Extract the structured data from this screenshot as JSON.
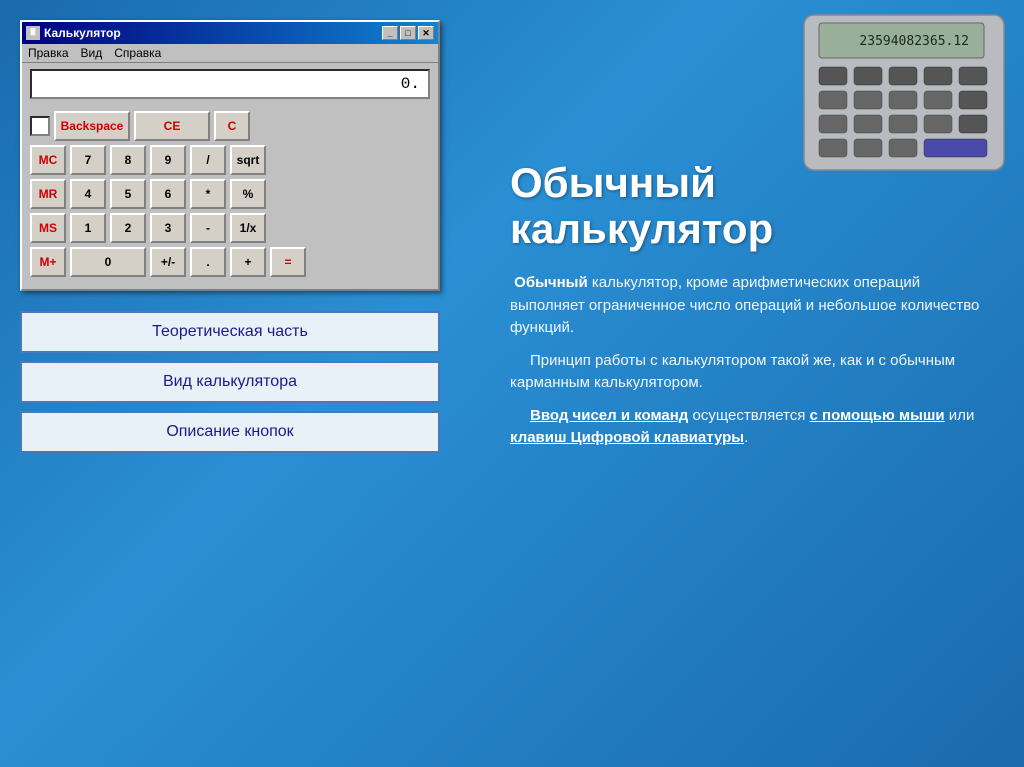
{
  "title": "Калькулятор",
  "titlebar": {
    "title": "Калькулятор",
    "min_btn": "_",
    "max_btn": "□",
    "close_btn": "✕"
  },
  "menubar": {
    "items": [
      "Правка",
      "Вид",
      "Справка"
    ]
  },
  "display": {
    "value": "0."
  },
  "buttons": {
    "row1": {
      "backspace": "Backspace",
      "ce": "CE",
      "c": "C"
    },
    "row2": [
      "MC",
      "7",
      "8",
      "9",
      "/",
      "sqrt"
    ],
    "row3": [
      "MR",
      "4",
      "5",
      "6",
      "*",
      "%"
    ],
    "row4": [
      "MS",
      "1",
      "2",
      "3",
      "-",
      "1/x"
    ],
    "row5": [
      "M+",
      "0",
      "+/-",
      ".",
      "+",
      "="
    ]
  },
  "nav_buttons": [
    "Теоретическая часть",
    "Вид калькулятора",
    "Описание кнопок"
  ],
  "right_title": "Обычный\nкалькулятор",
  "paragraphs": [
    {
      "text": " Обычный калькулятор, кроме арифметических операций выполняет ограниченное число операций и небольшое количество функций.",
      "bold_start": "Обычный"
    },
    {
      "text": " Принцип работы с калькулятором такой же, как и с обычным карманным калькулятором."
    },
    {
      "text": " Ввод чисел и команд осуществляется с помощью мыши или клавиш Цифровой клавиатуры.",
      "links": [
        "Ввод чисел и команд",
        "с помощью\nмыши",
        "клавиш Цифровой\nклавиатуры"
      ]
    }
  ]
}
